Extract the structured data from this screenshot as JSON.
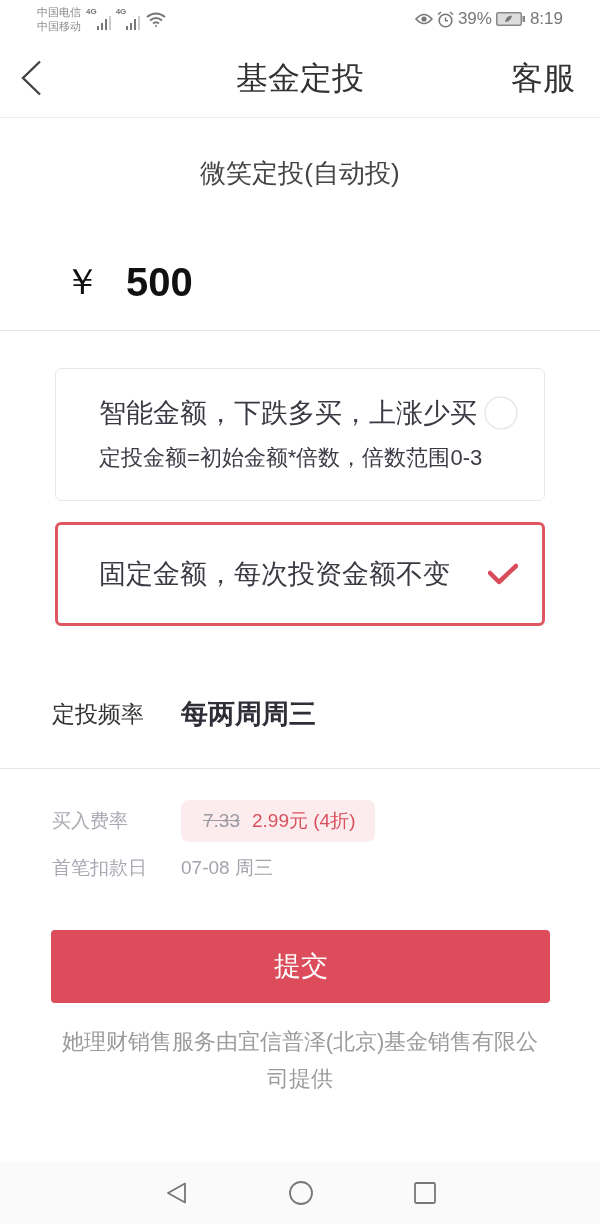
{
  "status_bar": {
    "carriers": [
      "中国电信",
      "中国移动"
    ],
    "network_labels": [
      "4G",
      "4G"
    ],
    "battery": "39%",
    "time": "8:19"
  },
  "header": {
    "title": "基金定投",
    "action": "客服"
  },
  "plan_name": "微笑定投(自动投)",
  "amount": {
    "currency": "￥",
    "value": "500"
  },
  "options": [
    {
      "title": "智能金额，下跌多买，上涨少买",
      "subtitle": "定投金额=初始金额*倍数，倍数范围0-3",
      "selected": false
    },
    {
      "title": "固定金额，每次投资金额不变",
      "selected": true
    }
  ],
  "frequency": {
    "label": "定投频率",
    "value": "每两周周三"
  },
  "details": [
    {
      "kind": "fee",
      "label": "买入费率",
      "original": "7.33",
      "value": "2.99元 (4折)"
    },
    {
      "kind": "text",
      "label": "首笔扣款日",
      "value": "07-08 周三"
    }
  ],
  "submit": "提交",
  "footer": "她理财销售服务由宜信普泽(北京)基金销售有限公司提供"
}
